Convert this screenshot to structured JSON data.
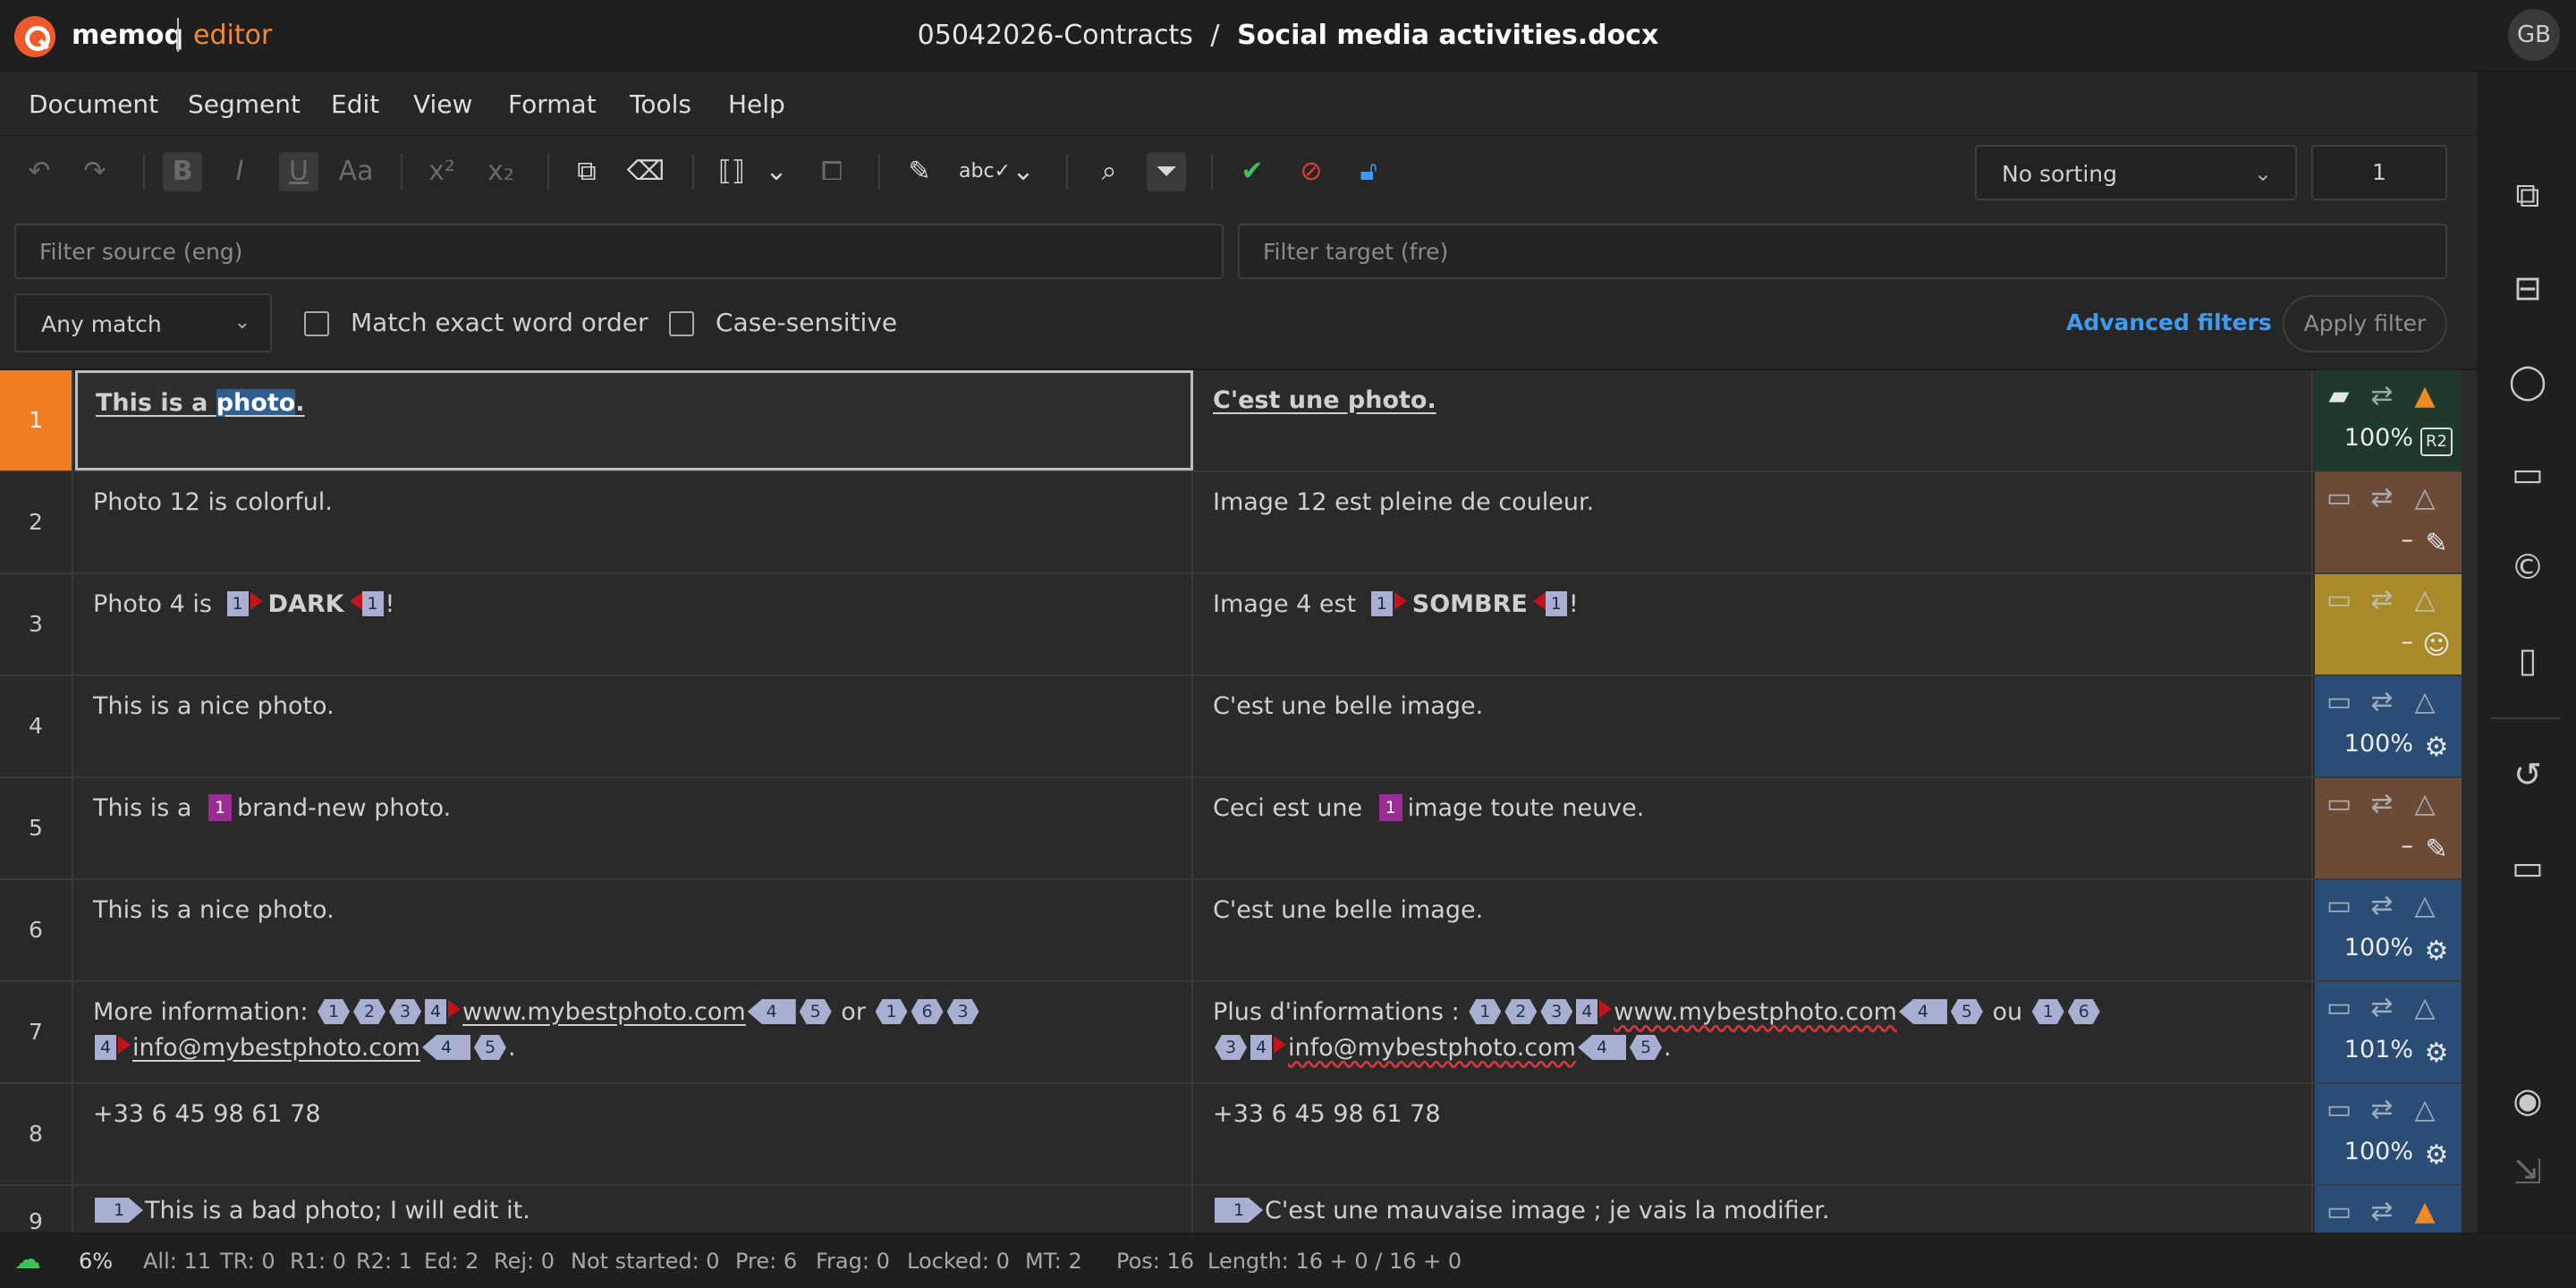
{
  "app": {
    "brand": "memoq",
    "module": "editor",
    "project": "05042026-Contracts",
    "title_sep": "/",
    "document": "Social media activities.docx",
    "user_initials": "GB"
  },
  "menu": [
    "Document",
    "Segment",
    "Edit",
    "View",
    "Format",
    "Tools",
    "Help"
  ],
  "toolbar": {
    "sorting": "No sorting",
    "goto_segment": "1"
  },
  "filters": {
    "source_placeholder": "Filter source (eng)",
    "target_placeholder": "Filter target (fre)",
    "match_mode": "Any match",
    "exact_word_order": "Match exact word order",
    "case_sensitive": "Case-sensitive",
    "advanced": "Advanced filters",
    "apply": "Apply filter"
  },
  "colors": {
    "accent": "#f07c24",
    "confirmed_r2": "#1f3a2c",
    "edited": "#6b4a36",
    "machine": "#a98a2a",
    "pretranslated": "#2a4d76",
    "link": "#3e9bf0"
  },
  "rows": [
    {
      "n": "1",
      "src_a": "This is a ",
      "src_hl": "photo",
      "src_b": ".",
      "tgt": "C'est une photo.",
      "pct": "100%",
      "status": "R2",
      "status_color": "#1f3a2c"
    },
    {
      "n": "2",
      "src": "Photo 12 is colorful.",
      "tgt": "Image 12 est pleine de couleur.",
      "pct": "–",
      "status": "edit-icon",
      "status_color": "#6b4a36"
    },
    {
      "n": "3",
      "src_a": "Photo 4 is ",
      "src_tagtxt": "DARK",
      "src_b": "!",
      "tgt_a": "Image 4 est ",
      "tgt_tagtxt": "SOMBRE",
      "tgt_b": "!",
      "tag": "1",
      "pct": "–",
      "status": "robot-icon",
      "status_color": "#a98a2a"
    },
    {
      "n": "4",
      "src": "This is a nice photo.",
      "tgt": "C'est une belle image.",
      "pct": "100%",
      "status": "tm-icon",
      "status_color": "#2a4d76"
    },
    {
      "n": "5",
      "src_a": "This is a ",
      "src_b": "brand-new photo.",
      "tgt_a": "Ceci est une ",
      "tgt_b": "image toute neuve.",
      "tag": "1",
      "pct": "–",
      "status": "edit-icon",
      "status_color": "#6b4a36"
    },
    {
      "n": "6",
      "src": "This is a nice photo.",
      "tgt": "C'est une belle image.",
      "pct": "100%",
      "status": "tm-icon",
      "status_color": "#2a4d76"
    },
    {
      "n": "7",
      "src_a": "More information: ",
      "src_url": "www.mybestphoto.com",
      "src_or": " or ",
      "src_mail": "info@mybestphoto.com",
      "src_end": ".",
      "tgt_a": "Plus d'informations : ",
      "tgt_url": "www.mybestphoto.com",
      "tgt_or": " ou ",
      "tgt_mail": "info@mybestphoto.com",
      "tgt_end": ".",
      "tags": [
        "1",
        "2",
        "3",
        "4",
        "5",
        "6"
      ],
      "pct": "101%",
      "status": "tm-icon",
      "status_color": "#2a4d76"
    },
    {
      "n": "8",
      "src": "+33 6 45 98 61 78",
      "tgt": "+33 6 45 98 61 78",
      "pct": "100%",
      "status": "tm-icon",
      "status_color": "#2a4d76"
    },
    {
      "n": "9",
      "src": "This is a bad photo; I will edit it.",
      "tgt": "C'est une mauvaise image ; je vais la modifier.",
      "tag": "1",
      "status_color": "#2a4d76"
    }
  ],
  "status": {
    "progress": "6%",
    "all": "All: 11",
    "tr": "TR: 0",
    "r1": "R1: 0",
    "r2": "R2: 1",
    "ed": "Ed: 2",
    "rej": "Rej: 0",
    "not_started": "Not started: 0",
    "pre": "Pre: 6",
    "frag": "Frag: 0",
    "locked": "Locked: 0",
    "mt": "MT: 2",
    "pos": "Pos: 16",
    "length": "Length: 16 + 0 / 16 + 0"
  }
}
